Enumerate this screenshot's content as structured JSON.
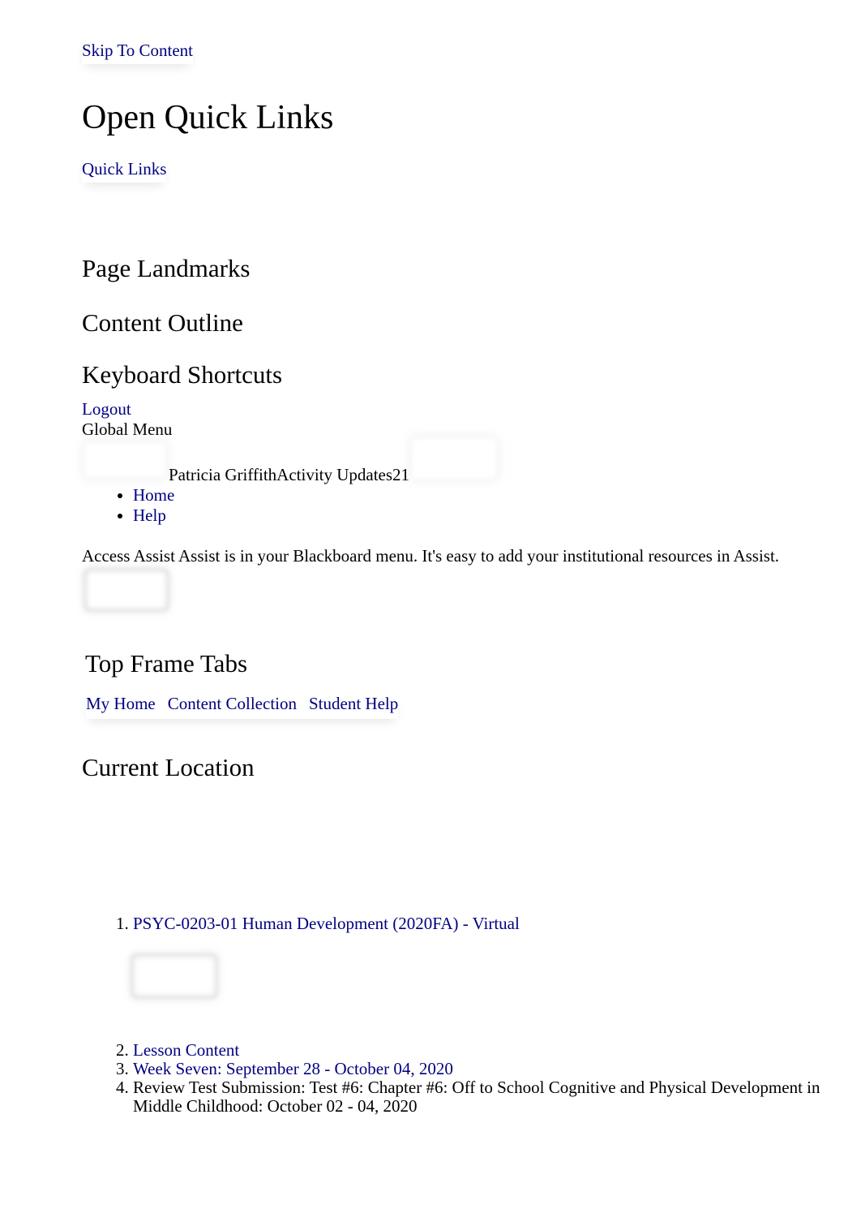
{
  "links": {
    "skip_to_content": "Skip To Content",
    "quick_links": "Quick Links",
    "logout": "Logout"
  },
  "headings": {
    "open_quick_links": "Open Quick Links",
    "page_landmarks": "Page Landmarks",
    "content_outline": "Content Outline",
    "keyboard_shortcuts": "Keyboard Shortcuts",
    "top_frame_tabs": "Top Frame Tabs",
    "current_location": "Current Location"
  },
  "global_menu": {
    "label": "Global Menu",
    "user_line": "Patricia GriffithActivity Updates21",
    "items": [
      {
        "label": "Home"
      },
      {
        "label": "Help"
      }
    ]
  },
  "assist": {
    "message": "Access Assist Assist is in your Blackboard menu. It's easy to add your institutional resources in Assist."
  },
  "tabs": [
    {
      "label": "My Home"
    },
    {
      "label": "Content Collection"
    },
    {
      "label": "Student Help"
    }
  ],
  "breadcrumbs": [
    {
      "label": "PSYC-0203-01 Human Development (2020FA) - Virtual",
      "link": true
    },
    {
      "label": "Lesson Content",
      "link": true
    },
    {
      "label": "Week Seven: September 28 - October 04, 2020",
      "link": true
    },
    {
      "label": "Review Test Submission: Test #6: Chapter #6: Off to School Cognitive and Physical Development in Middle Childhood: October 02 - 04, 2020",
      "link": false
    }
  ],
  "colors": {
    "link": "#000080",
    "text": "#000000",
    "background": "#ffffff"
  }
}
